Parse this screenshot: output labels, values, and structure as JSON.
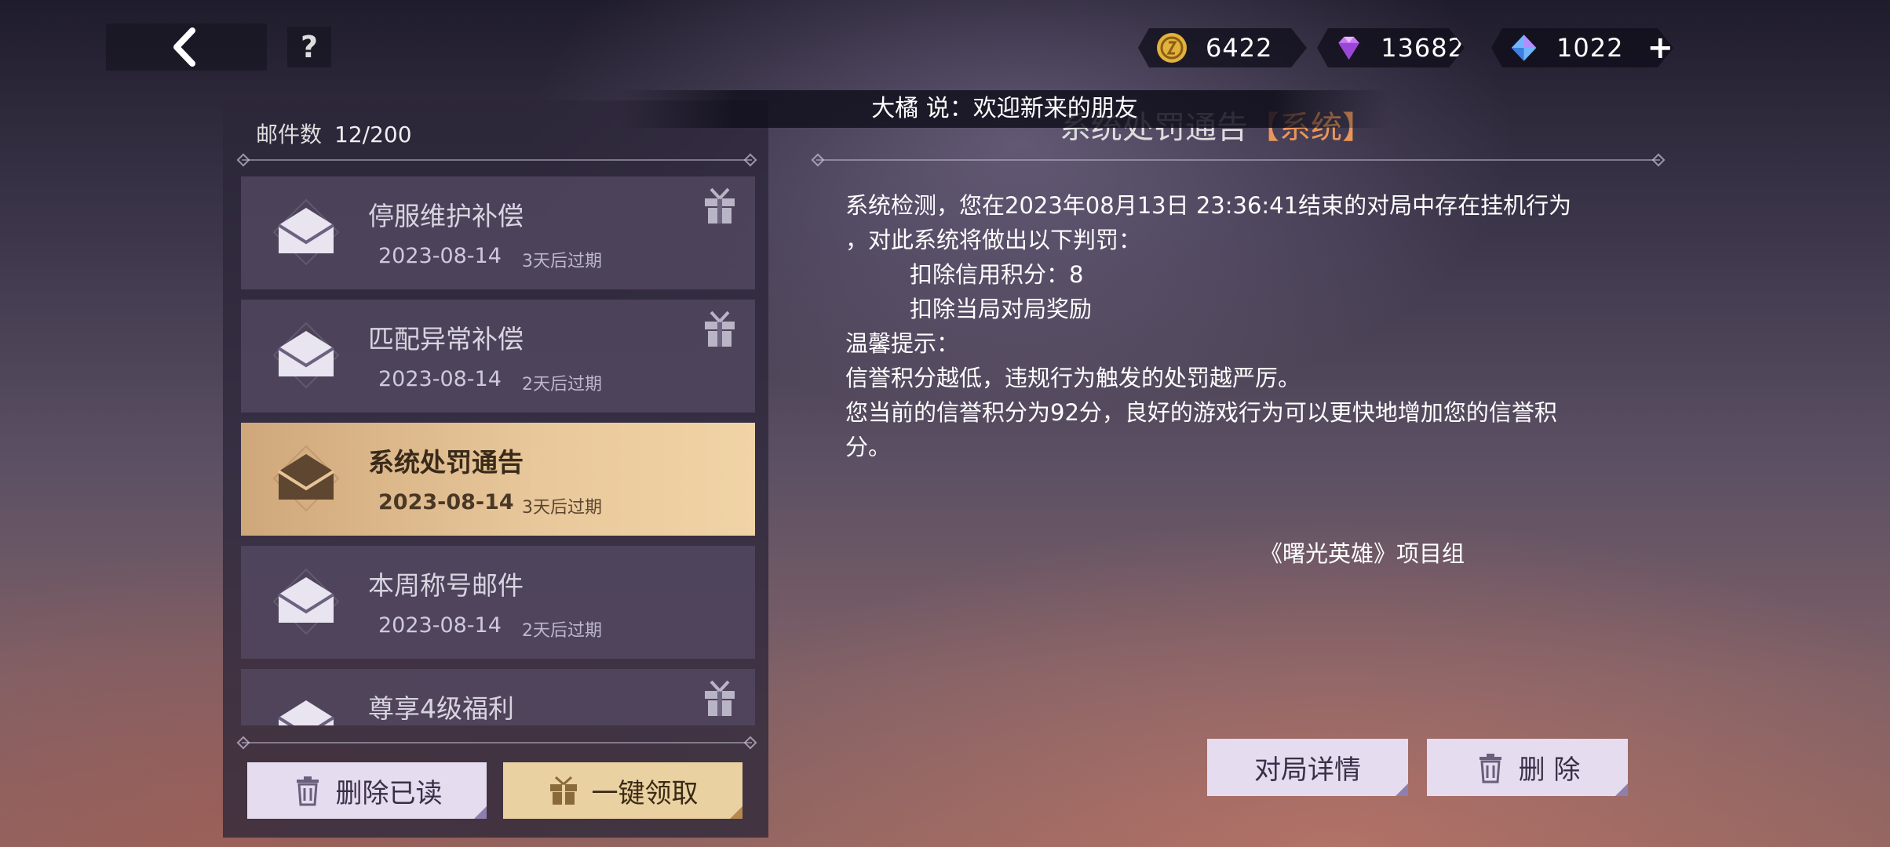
{
  "top": {
    "currencies": [
      {
        "icon": "gold-coin-icon",
        "value": "6422"
      },
      {
        "icon": "purple-diamond-icon",
        "value": "13682"
      },
      {
        "icon": "blue-crystal-icon",
        "value": "1022"
      }
    ],
    "help_label": "?",
    "plus_label": "+"
  },
  "chat": {
    "message": "大橘 说：欢迎新来的朋友"
  },
  "mailbox": {
    "count_label": "邮件数",
    "count_value": "12/200",
    "items": [
      {
        "title": "停服维护补偿",
        "date": "2023-08-14",
        "expire": "3天后过期",
        "has_gift": true
      },
      {
        "title": "匹配异常补偿",
        "date": "2023-08-14",
        "expire": "2天后过期",
        "has_gift": true
      },
      {
        "title": "系统处罚通告",
        "date": "2023-08-14",
        "expire": "3天后过期",
        "has_gift": false,
        "selected": true
      },
      {
        "title": "本周称号邮件",
        "date": "2023-08-14",
        "expire": "2天后过期",
        "has_gift": false
      },
      {
        "title": "尊享4级福利",
        "date": "",
        "expire": "",
        "has_gift": true
      }
    ],
    "delete_read_label": "删除已读",
    "claim_all_label": "一键领取"
  },
  "detail": {
    "title": "系统处罚通告",
    "tag": "【系统】",
    "lines": [
      "系统检测，您在2023年08月13日 23:36:41结束的对局中存在挂机行为",
      "，对此系统将做出以下判罚：",
      "扣除信用积分：8",
      "扣除当局对局奖励",
      "温馨提示：",
      "信誉积分越低，违规行为触发的处罚越严厉。",
      "您当前的信誉积分为92分，良好的游戏行为可以更快地增加您的信誉积",
      "分。"
    ],
    "signature": "《曙光英雄》项目组",
    "match_details_label": "对局详情",
    "delete_label": "删 除"
  },
  "colors": {
    "selected_bg": "#e9c99c",
    "tag": "#e9965a",
    "button_light": "#e6dcef",
    "button_gold": "#ead1a2"
  }
}
